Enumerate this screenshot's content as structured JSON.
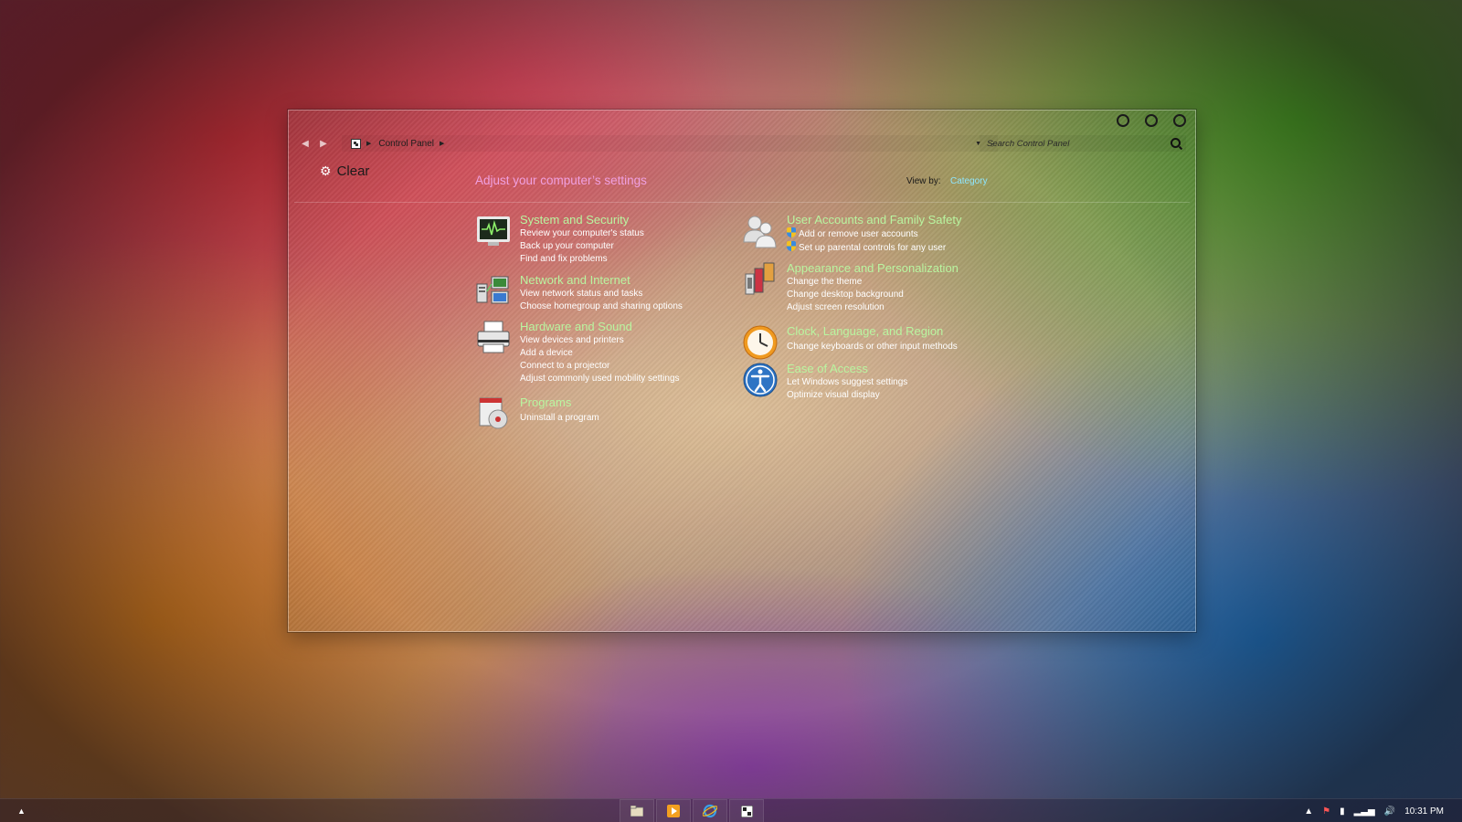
{
  "window": {
    "breadcrumb": "Control Panel",
    "search_placeholder": "Search Control Panel",
    "user_name": "Clear",
    "heading": "Adjust your computer’s settings",
    "viewby_label": "View by:",
    "viewby_value": "Category"
  },
  "categories": {
    "system": {
      "title": "System and Security",
      "links": [
        "Review your computer's status",
        "Back up your computer",
        "Find and fix problems"
      ]
    },
    "network": {
      "title": "Network and Internet",
      "links": [
        "View network status and tasks",
        "Choose homegroup and sharing options"
      ]
    },
    "hardware": {
      "title": "Hardware and Sound",
      "links": [
        "View devices and printers",
        "Add a device",
        "Connect to a projector",
        "Adjust commonly used mobility settings"
      ]
    },
    "programs": {
      "title": "Programs",
      "links": [
        "Uninstall a program"
      ]
    },
    "user": {
      "title": "User Accounts and Family Safety",
      "links": [
        "Add or remove user accounts",
        "Set up parental controls for any user"
      ]
    },
    "appearance": {
      "title": "Appearance and Personalization",
      "links": [
        "Change the theme",
        "Change desktop background",
        "Adjust screen resolution"
      ]
    },
    "clock": {
      "title": "Clock, Language, and Region",
      "links": [
        "Change keyboards or other input methods"
      ]
    },
    "ease": {
      "title": "Ease of Access",
      "links": [
        "Let Windows suggest settings",
        "Optimize visual display"
      ]
    }
  },
  "taskbar": {
    "clock": "10:31 PM"
  },
  "colors": {
    "category_title": "#b9f5a0",
    "heading": "#f0a0e0",
    "viewby_link": "#8ee6ff"
  }
}
